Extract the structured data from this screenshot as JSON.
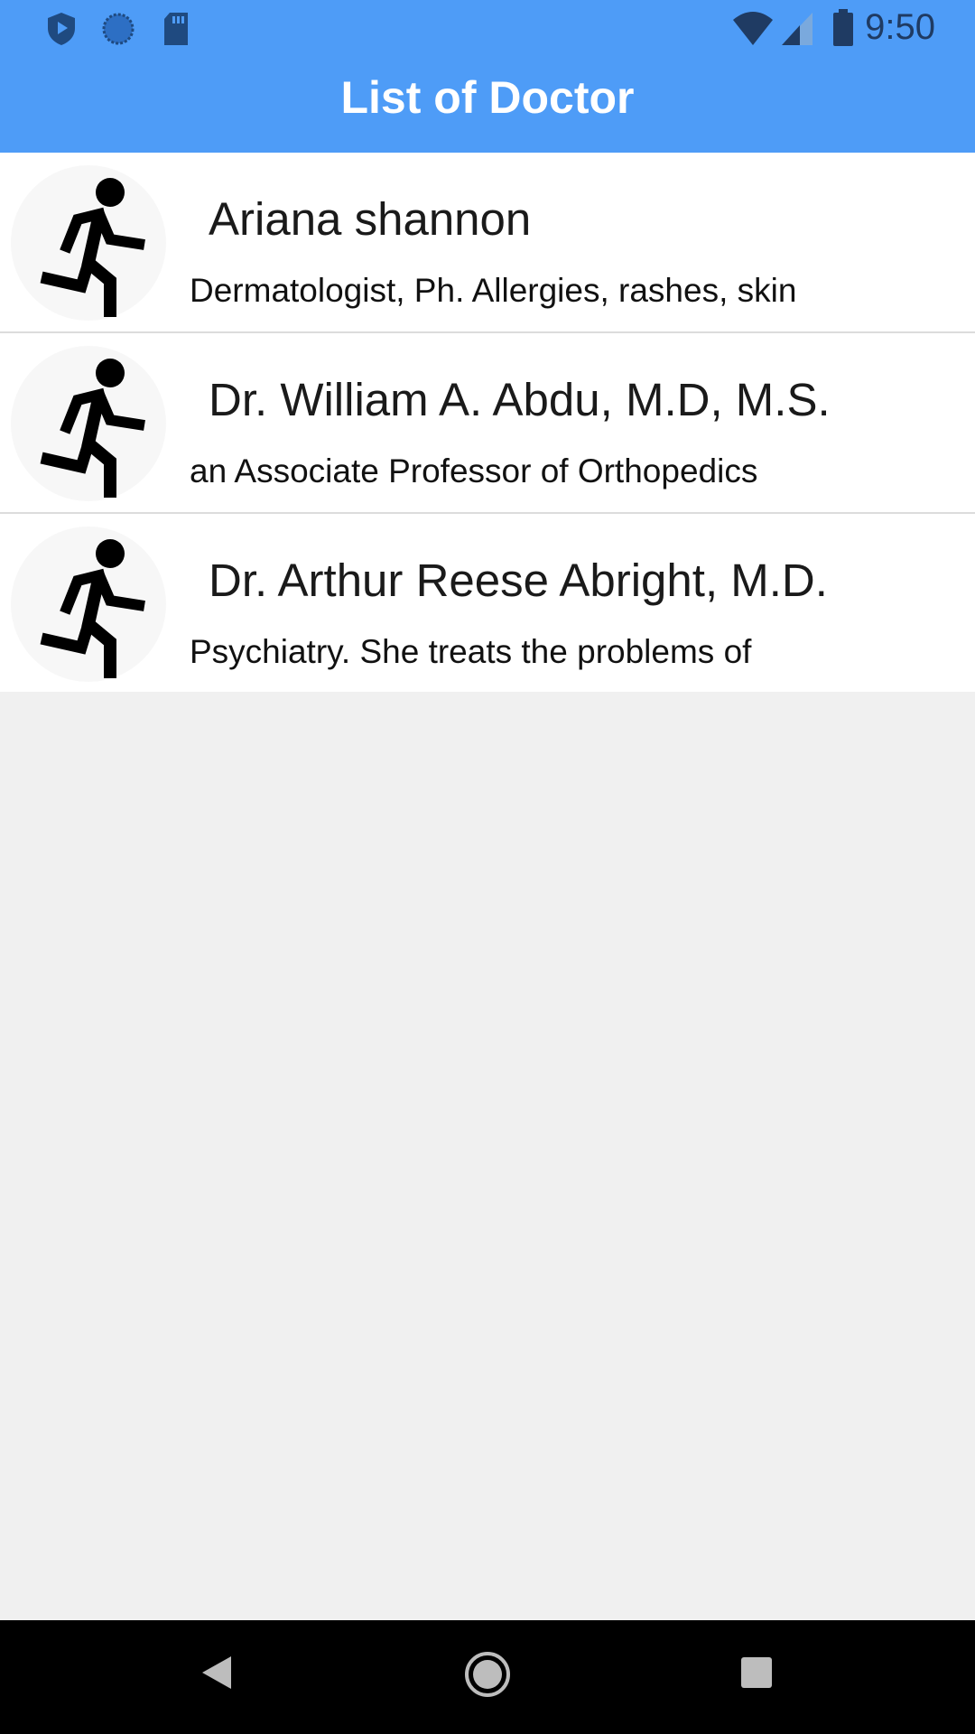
{
  "status_bar": {
    "time": "9:50",
    "left_icons": [
      "shield-icon",
      "sync-icon",
      "sd-card-icon"
    ],
    "right_icons": [
      "wifi-icon",
      "cellular-signal-icon",
      "battery-icon"
    ]
  },
  "app_bar": {
    "title": "List of Doctor",
    "color": "#4e9cf7"
  },
  "doctors": [
    {
      "name": "Ariana shannon",
      "description": "Dermatologist, Ph. Allergies, rashes, skin",
      "avatar_icon": "running-person-icon"
    },
    {
      "name": "Dr. William A. Abdu, M.D, M.S.",
      "description": "an Associate Professor of Orthopedics",
      "avatar_icon": "running-person-icon"
    },
    {
      "name": "Dr. Arthur Reese Abright, M.D.",
      "description": "Psychiatry. She treats the problems of",
      "avatar_icon": "running-person-icon"
    }
  ],
  "nav_bar": {
    "buttons": [
      "back-icon",
      "home-icon",
      "recents-icon"
    ]
  }
}
